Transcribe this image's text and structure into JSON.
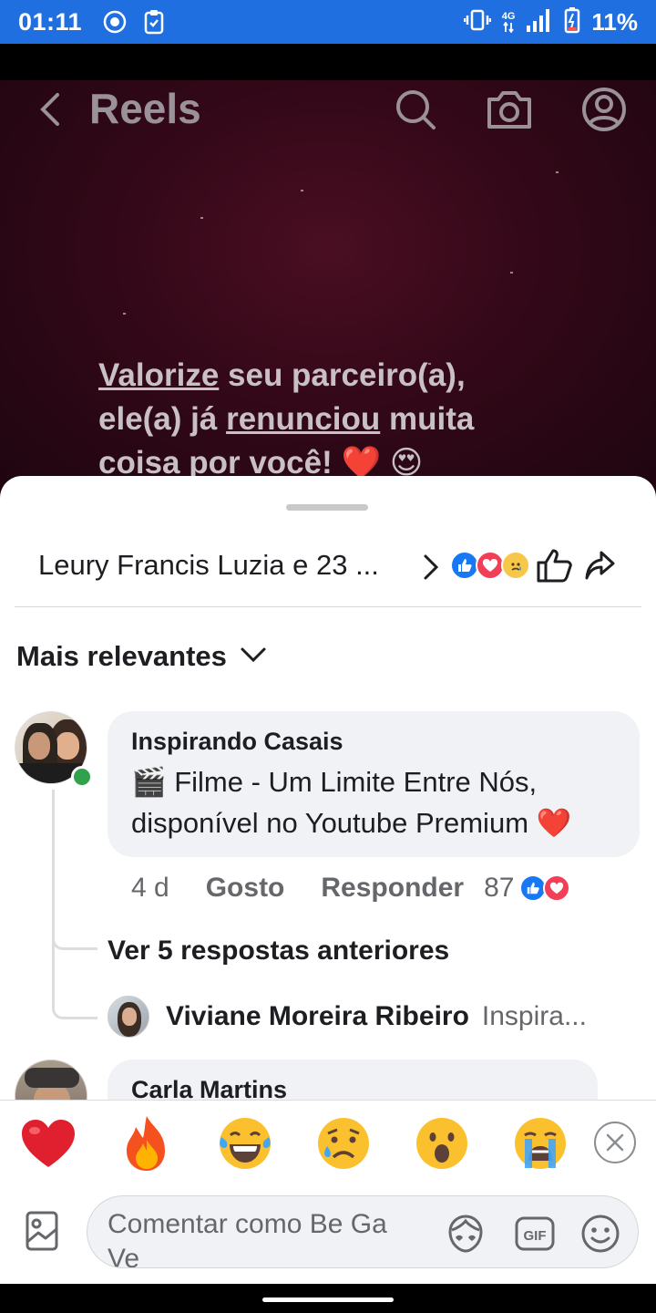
{
  "status_bar": {
    "time": "01:11",
    "network": "4G",
    "battery": "11%",
    "color": "#1f6fe0"
  },
  "reel": {
    "title": "Reels",
    "overlay_line1_a": "Valorize",
    "overlay_line1_b": " seu parceiro(a),",
    "overlay_line2_a": "ele(a) já ",
    "overlay_line2_b": "renunciou",
    "overlay_line2_c": " muita",
    "overlay_line3": "coisa por você! ❤️ 😍"
  },
  "sheet": {
    "reactors_text": "Leury Francis Luzia e 23 ...",
    "reactions": [
      "like",
      "love",
      "sad"
    ],
    "sort_label": "Mais relevantes"
  },
  "comment": {
    "author": "Inspirando Casais",
    "text": "🎬 Filme - Um Limite Entre Nós, disponível no Youtube Premium ❤️",
    "time": "4 d",
    "like_label": "Gosto",
    "reply_label": "Responder",
    "reaction_count": "87",
    "view_previous": "Ver 5 respostas anteriores",
    "reply": {
      "author": "Viviane Moreira Ribeiro",
      "snippet": "Inspira..."
    }
  },
  "comment2": {
    "author": "Carla Martins"
  },
  "quick_reactions": [
    "❤️",
    "🔥",
    "😂",
    "😥",
    "😮",
    "😭"
  ],
  "composer": {
    "placeholder": "Comentar como Be Ga Ve"
  }
}
